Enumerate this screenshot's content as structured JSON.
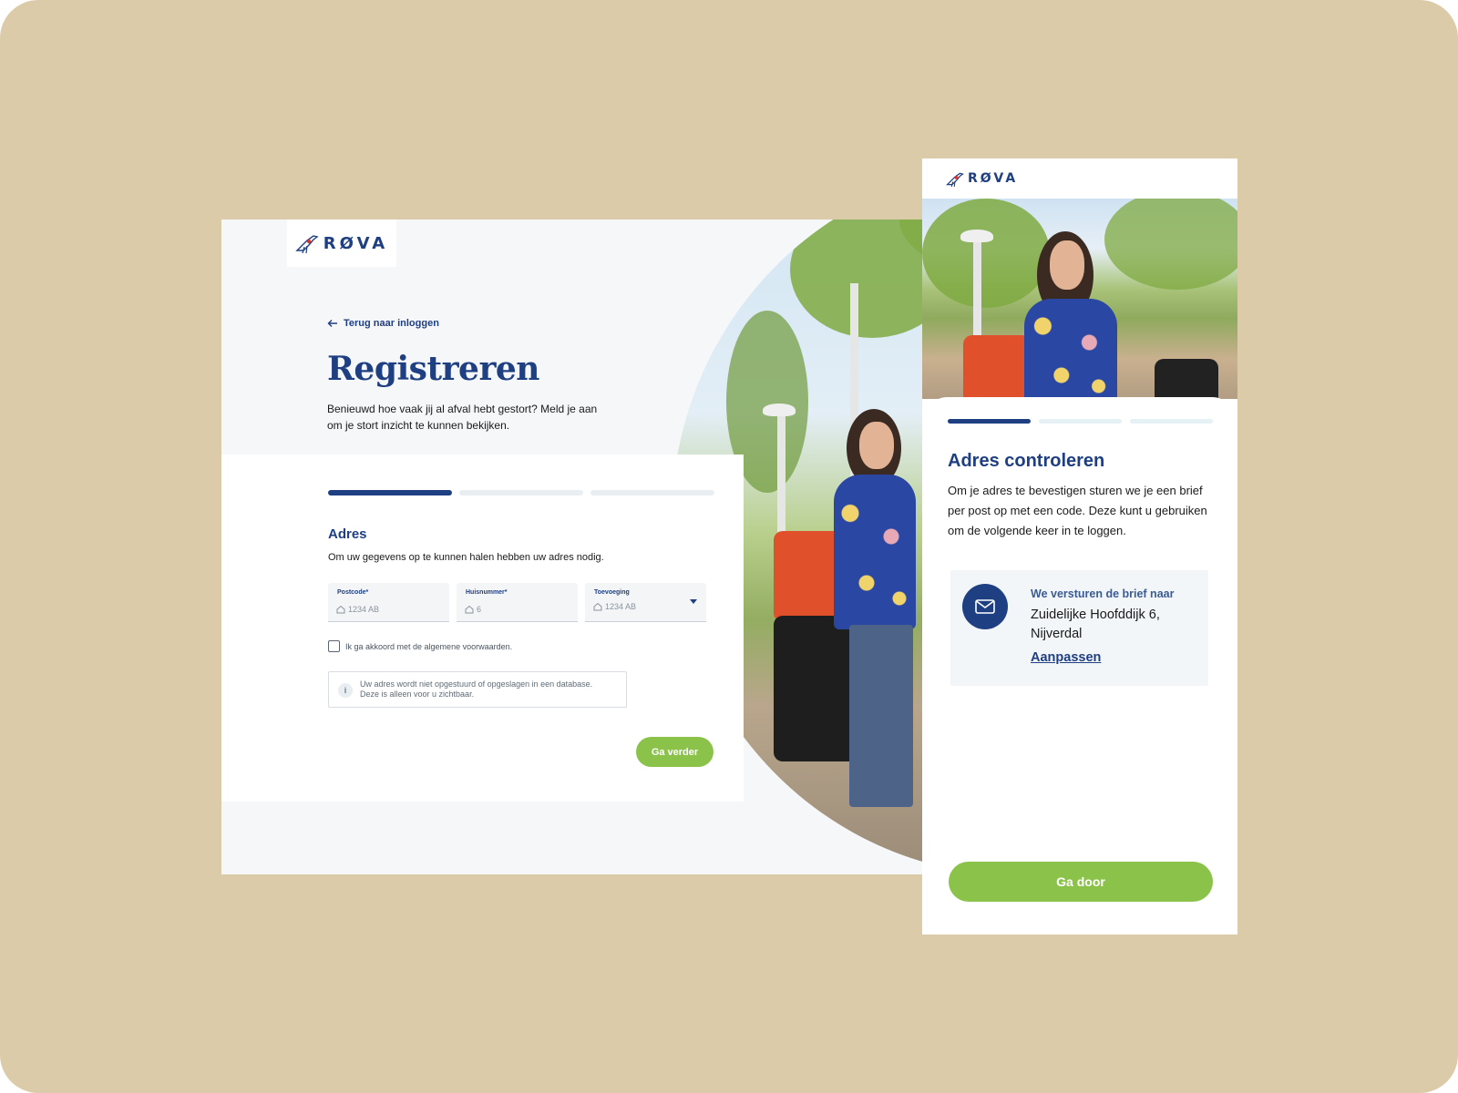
{
  "brand": {
    "name": "RØVA",
    "accent": "#1f3f83",
    "button": "#8bc34a",
    "frame_bg": "#dccba8"
  },
  "desktop": {
    "back_link": "Terug naar inloggen",
    "title": "Registreren",
    "intro": "Benieuwd hoe vaak jij al afval hebt gestort? Meld je aan om je stort inzicht te kunnen bekijken.",
    "progress": {
      "current_step": 1,
      "total_steps": 3
    },
    "section_title": "Adres",
    "section_sub": "Om uw gegevens op te kunnen halen hebben uw adres nodig.",
    "fields": {
      "postcode": {
        "label": "Postcode*",
        "placeholder": "1234 AB",
        "icon": "home-icon"
      },
      "huisnummer": {
        "label": "Huisnummer*",
        "placeholder": "6",
        "icon": "home-icon"
      },
      "toevoeging": {
        "label": "Toevoeging",
        "placeholder": "1234 AB",
        "icon": "home-icon"
      }
    },
    "terms_label": "Ik ga akkoord met de algemene voorwaarden.",
    "info_text": "Uw adres wordt niet opgestuurd of opgeslagen in een database. Deze is alleen voor u zichtbaar.",
    "next_button": "Ga verder"
  },
  "mobile": {
    "progress": {
      "current_step": 1,
      "total_steps": 3
    },
    "title": "Adres controleren",
    "text": "Om je adres te bevestigen sturen we je een brief per post op met een code. Deze kunt u gebruiken om de volgende keer in te loggen.",
    "info_label": "We versturen de brief naar",
    "address": "Zuidelijke Hoofddijk 6, Nijverdal",
    "edit_link": "Aanpassen",
    "button": "Ga door"
  }
}
